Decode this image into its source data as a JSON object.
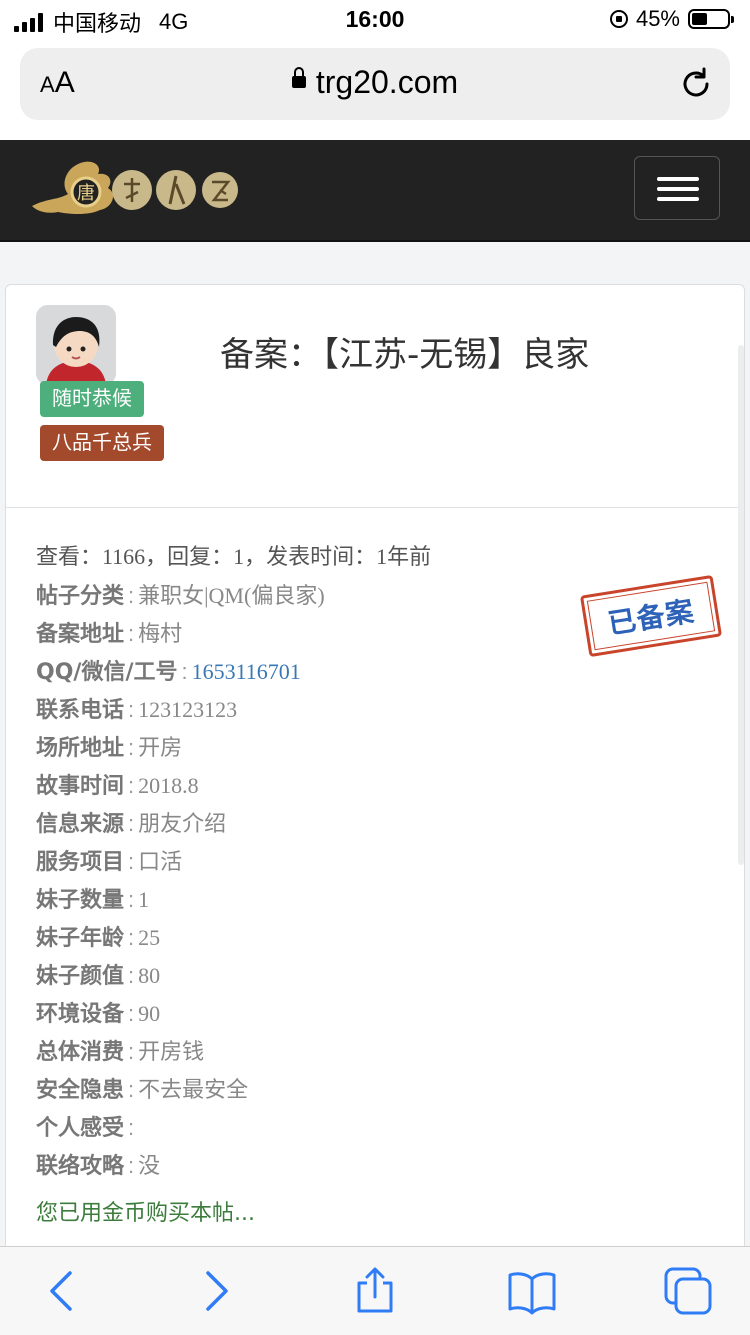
{
  "status_bar": {
    "carrier": "中国移动",
    "network": "4G",
    "time": "16:00",
    "battery_percent": "45%",
    "battery_level": 0.45
  },
  "browser": {
    "text_size_label": "AA",
    "url": "trg20.com"
  },
  "site": {
    "logo_icon": "dragon-logo",
    "menu_icon": "hamburger-icon"
  },
  "post": {
    "title": "备案：【江苏-无锡】良家",
    "badges": [
      "随时恭候",
      "八品千总兵"
    ],
    "meta": "查看：1166，回复：1，发表时间：1年前",
    "stamp": "已备案",
    "fields": [
      {
        "key": "帖子分类",
        "value": "兼职女|QM(偏良家)"
      },
      {
        "key": "备案地址",
        "value": "梅村"
      },
      {
        "key": "QQ/微信/工号",
        "value": "1653116701"
      },
      {
        "key": "联系电话",
        "value": "123123123"
      },
      {
        "key": "场所地址",
        "value": "开房"
      },
      {
        "key": "故事时间",
        "value": "2018.8"
      },
      {
        "key": "信息来源",
        "value": "朋友介绍"
      },
      {
        "key": "服务项目",
        "value": "口活"
      },
      {
        "key": "妹子数量",
        "value": "1"
      },
      {
        "key": "妹子年龄",
        "value": "25"
      },
      {
        "key": "妹子颜值",
        "value": "80"
      },
      {
        "key": "环境设备",
        "value": "90"
      },
      {
        "key": "总体消费",
        "value": "开房钱"
      },
      {
        "key": "安全隐患",
        "value": "不去最安全"
      },
      {
        "key": "个人感受",
        "value": ""
      },
      {
        "key": "联络攻略",
        "value": "没"
      }
    ],
    "separator": ":",
    "purchased_note": "您已用金币购买本帖..."
  }
}
